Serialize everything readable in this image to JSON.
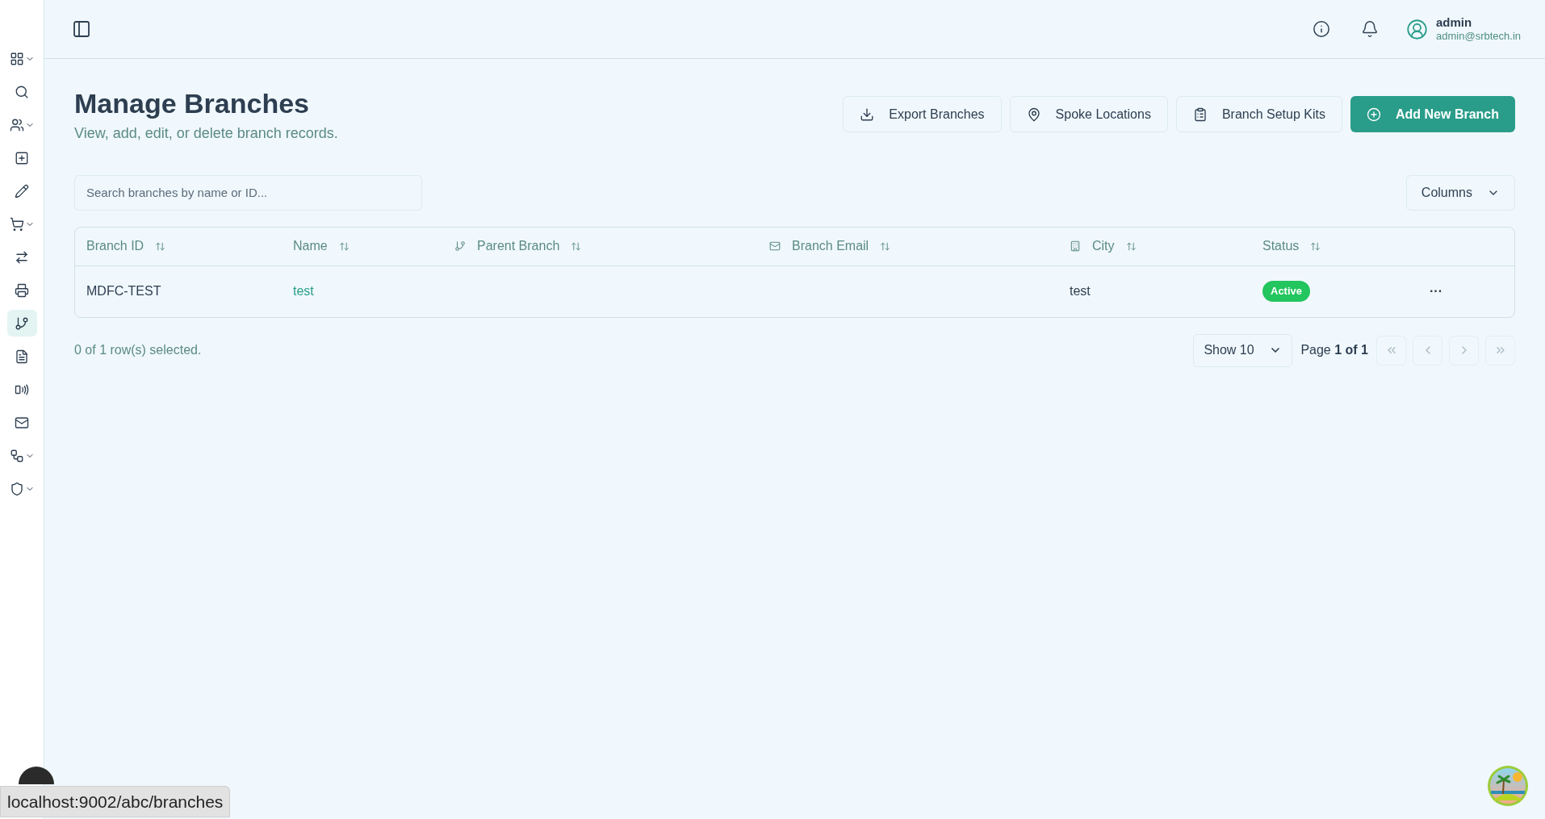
{
  "sidebar": {
    "items": [
      {
        "expandable": true,
        "selected": false
      },
      {
        "expandable": false,
        "selected": false
      },
      {
        "expandable": true,
        "selected": false
      },
      {
        "expandable": false,
        "selected": false
      },
      {
        "expandable": false,
        "selected": false
      },
      {
        "expandable": true,
        "selected": false
      },
      {
        "expandable": false,
        "selected": false
      },
      {
        "expandable": false,
        "selected": false
      },
      {
        "expandable": false,
        "selected": true
      },
      {
        "expandable": false,
        "selected": false
      },
      {
        "expandable": false,
        "selected": false
      },
      {
        "expandable": false,
        "selected": false
      },
      {
        "expandable": true,
        "selected": false
      },
      {
        "expandable": true,
        "selected": false
      }
    ]
  },
  "header": {
    "user": {
      "name": "admin",
      "email": "admin@srbtech.in"
    }
  },
  "page": {
    "title": "Manage Branches",
    "subtitle": "View, add, edit, or delete branch records.",
    "actions": [
      {
        "label": "Export Branches",
        "kind": "outline"
      },
      {
        "label": "Spoke Locations",
        "kind": "outline"
      },
      {
        "label": "Branch Setup Kits",
        "kind": "outline"
      },
      {
        "label": "Add New Branch",
        "kind": "primary"
      }
    ]
  },
  "search": {
    "placeholder": "Search branches by name or ID..."
  },
  "columns_button": "Columns",
  "table": {
    "columns": [
      "Branch ID",
      "Name",
      "Parent Branch",
      "Branch Email",
      "City",
      "Status"
    ],
    "rows": [
      {
        "branch_id": "MDFC-TEST",
        "name": "test",
        "parent_branch": "",
        "branch_email": "",
        "city": "test",
        "status": "Active",
        "actions": "···"
      }
    ]
  },
  "footer": {
    "selection": "0 of 1 row(s) selected.",
    "page_size": "Show 10",
    "page": "Page **1 of 1**",
    "nav": [
      {
        "kind": "first",
        "disabled": true
      },
      {
        "kind": "prev",
        "disabled": true
      },
      {
        "kind": "next",
        "disabled": true
      },
      {
        "kind": "last",
        "disabled": true
      }
    ]
  },
  "status_url": "localhost:9002/abc/branches"
}
